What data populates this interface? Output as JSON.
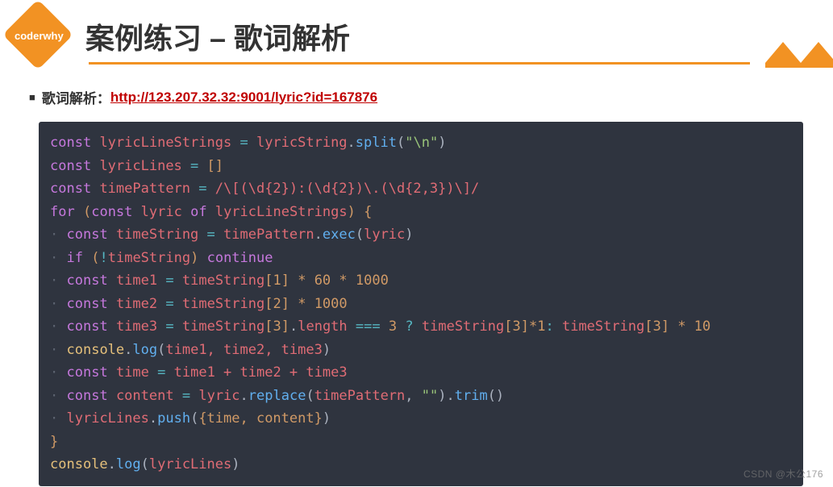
{
  "logo": {
    "text": "coderwhy"
  },
  "title": "案例练习 – 歌词解析",
  "intro": {
    "label": "歌词解析：",
    "url_text": "http://123.207.32.32:9001/lyric?id=167876",
    "url_href": "http://123.207.32.32:9001/lyric?id=167876"
  },
  "code": {
    "l1": {
      "kw": "const",
      "v": "lyricLineStrings",
      "eq": "=",
      "obj": "lyricString",
      "fn": "split",
      "arg": "\"\\n\""
    },
    "l2": {
      "kw": "const",
      "v": "lyricLines",
      "eq": "=",
      "val": "[]"
    },
    "l3": {
      "kw": "const",
      "v": "timePattern",
      "eq": "=",
      "re": "/\\[(\\d{2}):(\\d{2})\\.(\\d{2,3})\\]/"
    },
    "l4": {
      "kw_for": "for",
      "lp": "(",
      "kw_const": "const",
      "v": "lyric",
      "kw_of": "of",
      "iter": "lyricLineStrings",
      "rp": ") {"
    },
    "l5": {
      "kw": "const",
      "v": "timeString",
      "eq": "=",
      "obj": "timePattern",
      "fn": "exec",
      "arg": "lyric"
    },
    "l6": {
      "kw_if": "if",
      "lp": "(",
      "not": "!",
      "v": "timeString",
      "rp": ")",
      "kw_cont": "continue"
    },
    "l7": {
      "kw": "const",
      "v": "time1",
      "eq": "=",
      "obj": "timeString",
      "idx": "1",
      "rest": " * 60 * 1000"
    },
    "l8": {
      "kw": "const",
      "v": "time2",
      "eq": "=",
      "obj": "timeString",
      "idx": "2",
      "rest": " * 1000"
    },
    "l9": {
      "kw": "const",
      "v": "time3",
      "eq": "=",
      "obj": "timeString",
      "idx": "3",
      "dot": ".",
      "prop": "length",
      "cmp": "===",
      "three": "3",
      "q": "?",
      "obj2": "timeString",
      "idx2": "3",
      "mul1": "*1",
      "col": ":",
      "obj3": "timeString",
      "idx3": "3",
      "mul10": " * 10"
    },
    "l10": {
      "obj": "console",
      "fn": "log",
      "args": "time1, time2, time3"
    },
    "l11": {
      "kw": "const",
      "v": "time",
      "eq": "=",
      "expr": "time1 + time2 + time3"
    },
    "l12": {
      "kw": "const",
      "v": "content",
      "eq": "=",
      "obj": "lyric",
      "fn1": "replace",
      "arg1a": "timePattern",
      "arg1b": "\"\"",
      "fn2": "trim"
    },
    "l13": {
      "obj": "lyricLines",
      "fn": "push",
      "args": "{time, content}"
    },
    "l14": {
      "brace": "}"
    },
    "l15": {
      "obj": "console",
      "fn": "log",
      "args": "lyricLines"
    }
  },
  "watermark": "CSDN @木公176"
}
